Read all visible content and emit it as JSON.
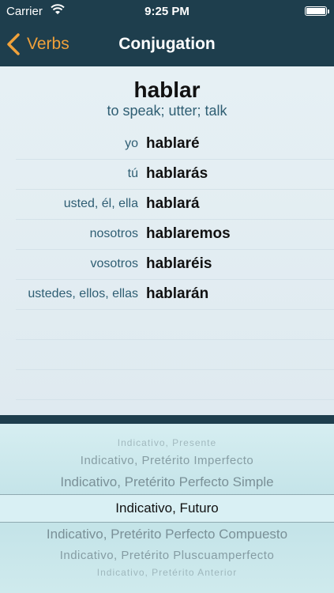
{
  "status": {
    "carrier": "Carrier",
    "time": "9:25 PM"
  },
  "nav": {
    "back_label": "Verbs",
    "title": "Conjugation"
  },
  "verb": {
    "infinitive": "hablar",
    "meaning": "to speak; utter; talk"
  },
  "conjugations": [
    {
      "pronoun": "yo",
      "form": "hablaré"
    },
    {
      "pronoun": "tú",
      "form": "hablarás"
    },
    {
      "pronoun": "usted, él, ella",
      "form": "hablará"
    },
    {
      "pronoun": "nosotros",
      "form": "hablaremos"
    },
    {
      "pronoun": "vosotros",
      "form": "hablaréis"
    },
    {
      "pronoun": "ustedes, ellos, ellas",
      "form": "hablarán"
    }
  ],
  "picker": {
    "options": [
      "Indicativo, Presente",
      "Indicativo, Pretérito Imperfecto",
      "Indicativo, Pretérito Perfecto Simple",
      "Indicativo, Futuro",
      "Indicativo, Pretérito Perfecto Compuesto",
      "Indicativo, Pretérito Pluscuamperfecto",
      "Indicativo, Pretérito Anterior"
    ],
    "selected": "Indicativo, Futuro"
  },
  "colors": {
    "nav_bg": "#1e3e4d",
    "accent": "#f0a13a",
    "pronoun_text": "#2f5e73"
  }
}
